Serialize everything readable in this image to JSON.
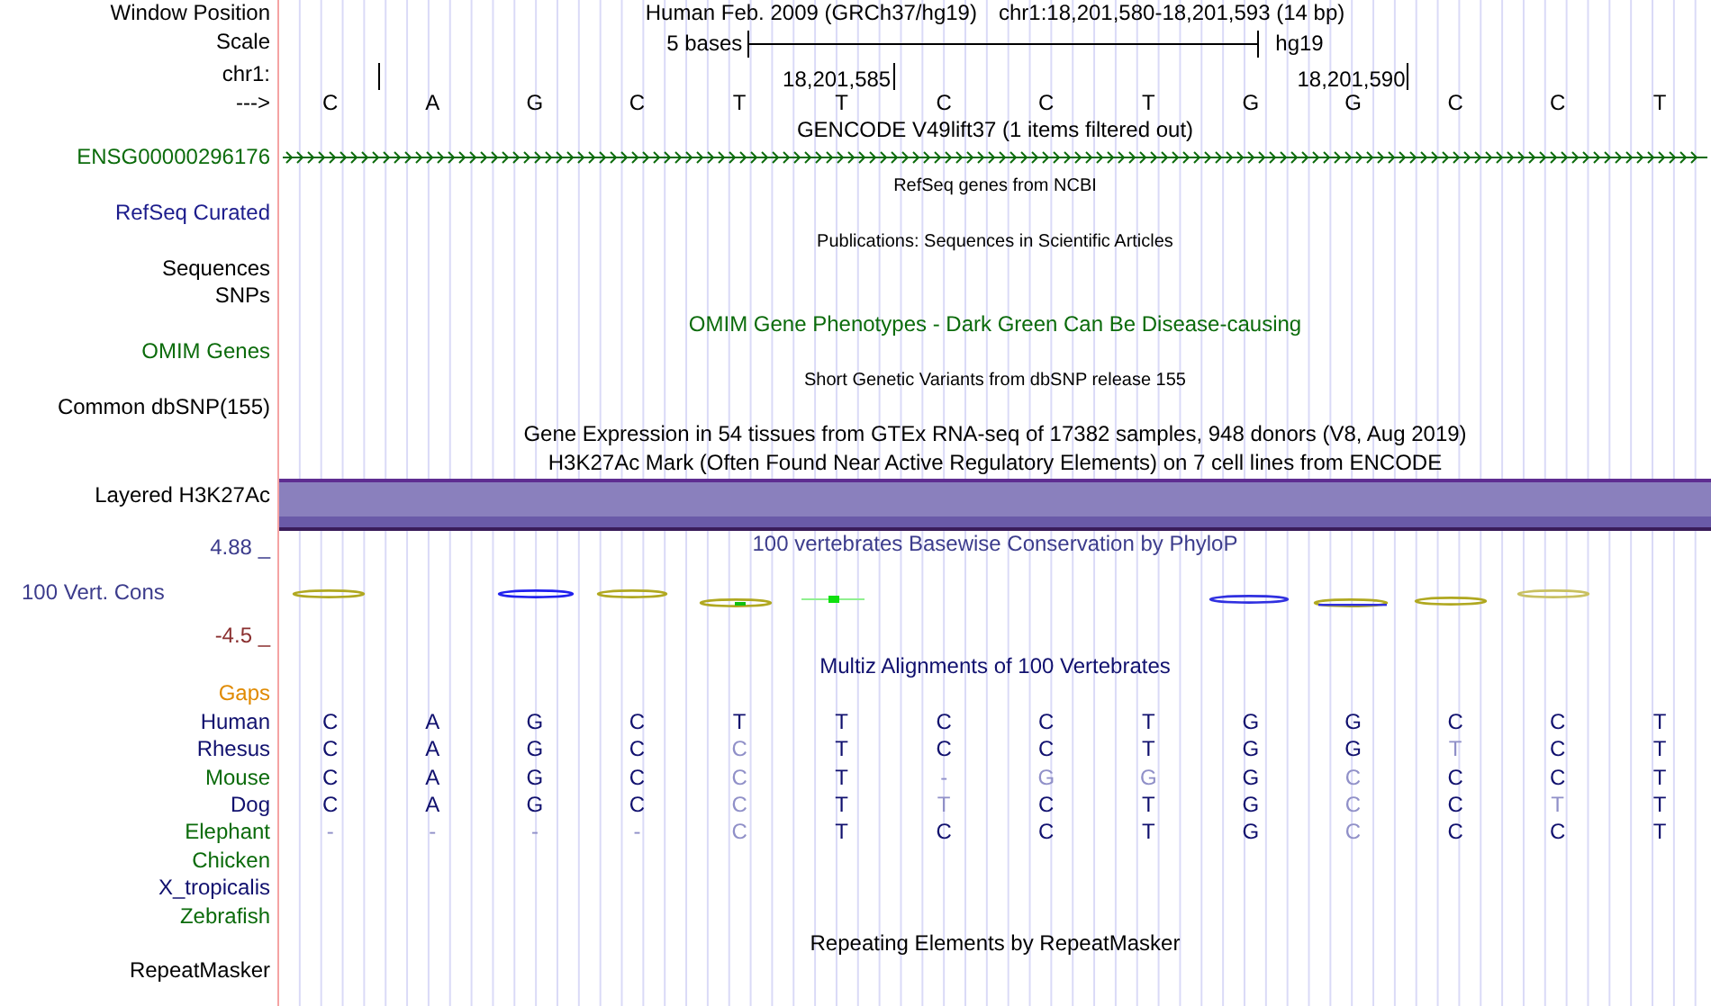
{
  "window_position": {
    "label": "Window Position",
    "assembly": "Human Feb. 2009 (GRCh37/hg19)",
    "position": "chr1:18,201,580-18,201,593 (14 bp)"
  },
  "scale": {
    "label": "Scale",
    "text": "5 bases",
    "db": "hg19"
  },
  "ruler": {
    "label": "chr1:",
    "strand_label": "--->",
    "bases": [
      {
        "letter": "C",
        "tick": true
      },
      {
        "letter": "A",
        "tick": false
      },
      {
        "letter": "G",
        "tick": false
      },
      {
        "letter": "C",
        "tick": false
      },
      {
        "letter": "T",
        "tick": false
      },
      {
        "letter": "T",
        "tick": true,
        "tick_label": "18,201,585"
      },
      {
        "letter": "C",
        "tick": false
      },
      {
        "letter": "C",
        "tick": false
      },
      {
        "letter": "T",
        "tick": false
      },
      {
        "letter": "G",
        "tick": false
      },
      {
        "letter": "G",
        "tick": true,
        "tick_label": "18,201,590"
      },
      {
        "letter": "C",
        "tick": false
      },
      {
        "letter": "C",
        "tick": false
      },
      {
        "letter": "T",
        "tick": false
      }
    ]
  },
  "tracks": [
    {
      "kind": "title",
      "title": "GENCODE V49lift37 (1 items filtered out)",
      "color": "#000000"
    },
    {
      "kind": "gene",
      "label": "ENSG00000296176",
      "color": "#0b6b0b"
    },
    {
      "kind": "note",
      "title": "RefSeq genes from NCBI",
      "color": "#000000"
    },
    {
      "kind": "label",
      "label": "RefSeq Curated",
      "color": "#1c1c8c"
    },
    {
      "kind": "note",
      "title": "Publications: Sequences in Scientific Articles",
      "color": "#000000"
    },
    {
      "kind": "label",
      "label": "Sequences",
      "color": "#000000"
    },
    {
      "kind": "label",
      "label": "SNPs",
      "color": "#000000"
    },
    {
      "kind": "title",
      "title": "OMIM Gene Phenotypes - Dark Green Can Be Disease-causing",
      "color": "#0b6b0b"
    },
    {
      "kind": "label",
      "label": "OMIM Genes",
      "color": "#0b6b0b"
    },
    {
      "kind": "note",
      "title": "Short Genetic Variants from dbSNP release 155",
      "color": "#000000"
    },
    {
      "kind": "label",
      "label": "Common dbSNP(155)",
      "color": "#000000"
    },
    {
      "kind": "title",
      "title": "Gene Expression in 54 tissues from GTEx RNA-seq of 17382 samples, 948 donors (V8, Aug 2019)",
      "color": "#000000"
    },
    {
      "kind": "title",
      "title": "H3K27Ac Mark (Often Found Near Active Regulatory Elements) on 7 cell lines from ENCODE",
      "color": "#000000"
    },
    {
      "kind": "band",
      "label": "Layered H3K27Ac",
      "color": "#000000"
    },
    {
      "kind": "wiggle",
      "label": "100 Vert. Cons",
      "title": "100 vertebrates Basewise Conservation by PhyloP",
      "max": "4.88 _",
      "min": "-4.5 _",
      "color": "#3c3c8c"
    },
    {
      "kind": "title",
      "title": "Multiz Alignments of 100 Vertebrates",
      "color": "#10106e"
    },
    {
      "kind": "label",
      "label": "Gaps",
      "color": "#e08a00"
    },
    {
      "kind": "species",
      "label": "Human",
      "color": "#10106e",
      "bases": [
        {
          "letter": "C",
          "match": true
        },
        {
          "letter": "A",
          "match": true
        },
        {
          "letter": "G",
          "match": true
        },
        {
          "letter": "C",
          "match": true
        },
        {
          "letter": "T",
          "match": true
        },
        {
          "letter": "T",
          "match": true
        },
        {
          "letter": "C",
          "match": true
        },
        {
          "letter": "C",
          "match": true
        },
        {
          "letter": "T",
          "match": true
        },
        {
          "letter": "G",
          "match": true
        },
        {
          "letter": "G",
          "match": true
        },
        {
          "letter": "C",
          "match": true
        },
        {
          "letter": "C",
          "match": true
        },
        {
          "letter": "T",
          "match": true
        }
      ]
    },
    {
      "kind": "species",
      "label": "Rhesus",
      "color": "#10106e",
      "bases": [
        {
          "letter": "C",
          "match": true
        },
        {
          "letter": "A",
          "match": true
        },
        {
          "letter": "G",
          "match": true
        },
        {
          "letter": "C",
          "match": true
        },
        {
          "letter": "C",
          "match": false
        },
        {
          "letter": "T",
          "match": true
        },
        {
          "letter": "C",
          "match": true
        },
        {
          "letter": "C",
          "match": true
        },
        {
          "letter": "T",
          "match": true
        },
        {
          "letter": "G",
          "match": true
        },
        {
          "letter": "G",
          "match": true
        },
        {
          "letter": "T",
          "match": false
        },
        {
          "letter": "C",
          "match": true
        },
        {
          "letter": "T",
          "match": true
        }
      ]
    },
    {
      "kind": "species",
      "label": "Mouse",
      "color": "#0b6b0b",
      "bases": [
        {
          "letter": "C",
          "match": true
        },
        {
          "letter": "A",
          "match": true
        },
        {
          "letter": "G",
          "match": true
        },
        {
          "letter": "C",
          "match": true
        },
        {
          "letter": "C",
          "match": false
        },
        {
          "letter": "T",
          "match": true
        },
        {
          "letter": "-",
          "match": false
        },
        {
          "letter": "G",
          "match": false
        },
        {
          "letter": "G",
          "match": false
        },
        {
          "letter": "G",
          "match": true
        },
        {
          "letter": "C",
          "match": false
        },
        {
          "letter": "C",
          "match": true
        },
        {
          "letter": "C",
          "match": true
        },
        {
          "letter": "T",
          "match": true
        }
      ]
    },
    {
      "kind": "species",
      "label": "Dog",
      "color": "#10106e",
      "bases": [
        {
          "letter": "C",
          "match": true
        },
        {
          "letter": "A",
          "match": true
        },
        {
          "letter": "G",
          "match": true
        },
        {
          "letter": "C",
          "match": true
        },
        {
          "letter": "C",
          "match": false
        },
        {
          "letter": "T",
          "match": true
        },
        {
          "letter": "T",
          "match": false
        },
        {
          "letter": "C",
          "match": true
        },
        {
          "letter": "T",
          "match": true
        },
        {
          "letter": "G",
          "match": true
        },
        {
          "letter": "C",
          "match": false
        },
        {
          "letter": "C",
          "match": true
        },
        {
          "letter": "T",
          "match": false
        },
        {
          "letter": "T",
          "match": true
        }
      ]
    },
    {
      "kind": "species",
      "label": "Elephant",
      "color": "#0b6b0b",
      "bases": [
        {
          "letter": "-",
          "match": false
        },
        {
          "letter": "-",
          "match": false
        },
        {
          "letter": "-",
          "match": false
        },
        {
          "letter": "-",
          "match": false
        },
        {
          "letter": "C",
          "match": false
        },
        {
          "letter": "T",
          "match": true
        },
        {
          "letter": "C",
          "match": true
        },
        {
          "letter": "C",
          "match": true
        },
        {
          "letter": "T",
          "match": true
        },
        {
          "letter": "G",
          "match": true
        },
        {
          "letter": "C",
          "match": false
        },
        {
          "letter": "C",
          "match": true
        },
        {
          "letter": "C",
          "match": true
        },
        {
          "letter": "T",
          "match": true
        }
      ]
    },
    {
      "kind": "species",
      "label": "Chicken",
      "color": "#0b6b0b"
    },
    {
      "kind": "species",
      "label": "X_tropicalis",
      "color": "#10106e"
    },
    {
      "kind": "species",
      "label": "Zebrafish",
      "color": "#0b6b0b"
    },
    {
      "kind": "title",
      "title": "Repeating Elements by RepeatMasker",
      "color": "#000000"
    },
    {
      "kind": "label",
      "label": "RepeatMasker",
      "color": "#000000"
    }
  ]
}
